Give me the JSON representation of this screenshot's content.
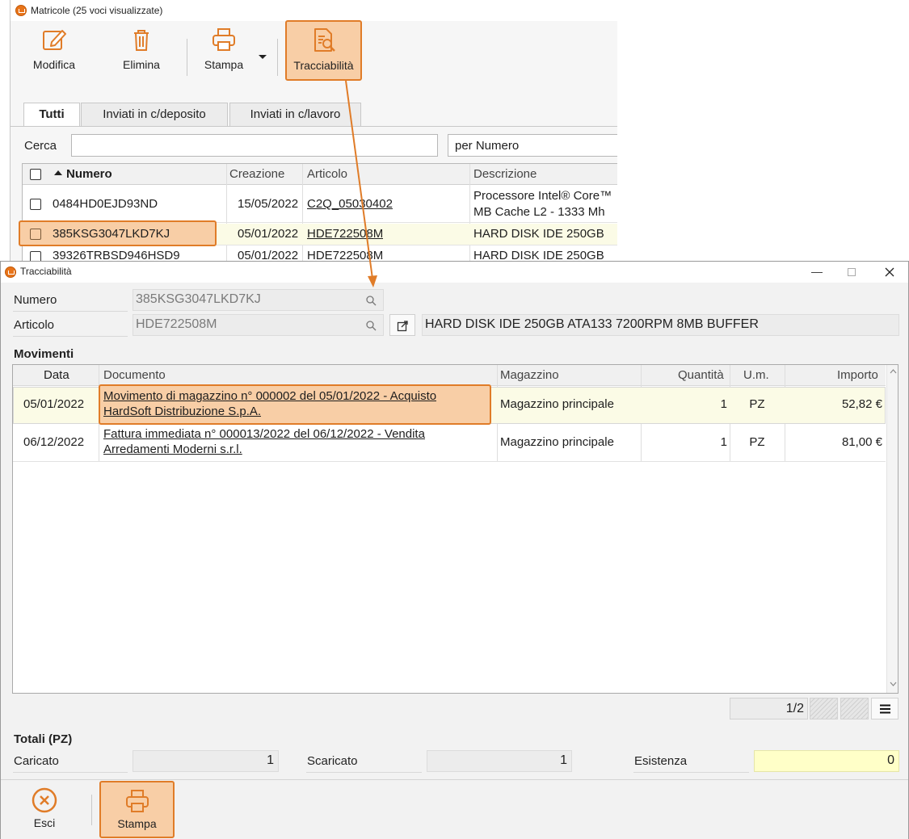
{
  "back_window": {
    "title": "Matricole (25 voci visualizzate)",
    "toolbar": {
      "modifica": "Modifica",
      "elimina": "Elimina",
      "stampa": "Stampa",
      "tracciabilita": "Tracciabilità"
    },
    "tabs": [
      "Tutti",
      "Inviati in c/deposito",
      "Inviati in c/lavoro"
    ],
    "search": {
      "label": "Cerca",
      "value": "",
      "sort_select": "per Numero"
    },
    "columns": [
      "Numero",
      "Creazione",
      "Articolo",
      "Descrizione"
    ],
    "rows": [
      {
        "numero": "0484HD0EJD93ND",
        "creazione": "15/05/2022",
        "articolo": "C2Q_05030402",
        "descrizione_1": "Processore Intel® Core™",
        "descrizione_2": "MB Cache L2 - 1333 Mh"
      },
      {
        "numero": "385KSG3047LKD7KJ",
        "creazione": "05/01/2022",
        "articolo": "HDE722508M",
        "descrizione_1": "HARD DISK IDE 250GB"
      },
      {
        "numero": "39326TRBSD946HSD9",
        "creazione": "05/01/2022",
        "articolo": "HDE722508M",
        "descrizione_1": "HARD DISK IDE 250GB"
      }
    ]
  },
  "front_window": {
    "title": "Tracciabilità",
    "numero_label": "Numero",
    "numero_value": "385KSG3047LKD7KJ",
    "articolo_label": "Articolo",
    "articolo_value": "HDE722508M",
    "articolo_desc": "HARD DISK IDE 250GB ATA133 7200RPM 8MB BUFFER",
    "movimenti_label": "Movimenti",
    "columns": [
      "Data",
      "Documento",
      "Magazzino",
      "Quantità",
      "U.m.",
      "Importo"
    ],
    "rows": [
      {
        "data": "05/01/2022",
        "doc_1": "Movimento di magazzino n° 000002 del 05/01/2022 - Acquisto",
        "doc_2": "HardSoft Distribuzione S.p.A.",
        "magazzino": "Magazzino principale",
        "quantita": "1",
        "um": "PZ",
        "importo": "52,82 €"
      },
      {
        "data": "06/12/2022",
        "doc_1": "Fattura immediata n° 000013/2022 del 06/12/2022 - Vendita",
        "doc_2": "Arredamenti Moderni s.r.l.",
        "magazzino": "Magazzino principale",
        "quantita": "1",
        "um": "PZ",
        "importo": "81,00 €"
      }
    ],
    "pager": "1/2",
    "totali": {
      "title": "Totali (PZ)",
      "caricato_label": "Caricato",
      "caricato_value": "1",
      "scaricato_label": "Scaricato",
      "scaricato_value": "1",
      "esistenza_label": "Esistenza",
      "esistenza_value": "0"
    },
    "bottom": {
      "esci": "Esci",
      "stampa": "Stampa"
    }
  },
  "colors": {
    "accent": "#e07c28",
    "highlight_fill": "#f8cea6",
    "selected_row": "#fbfbe6",
    "esistenza_fill": "#ffffc8"
  }
}
